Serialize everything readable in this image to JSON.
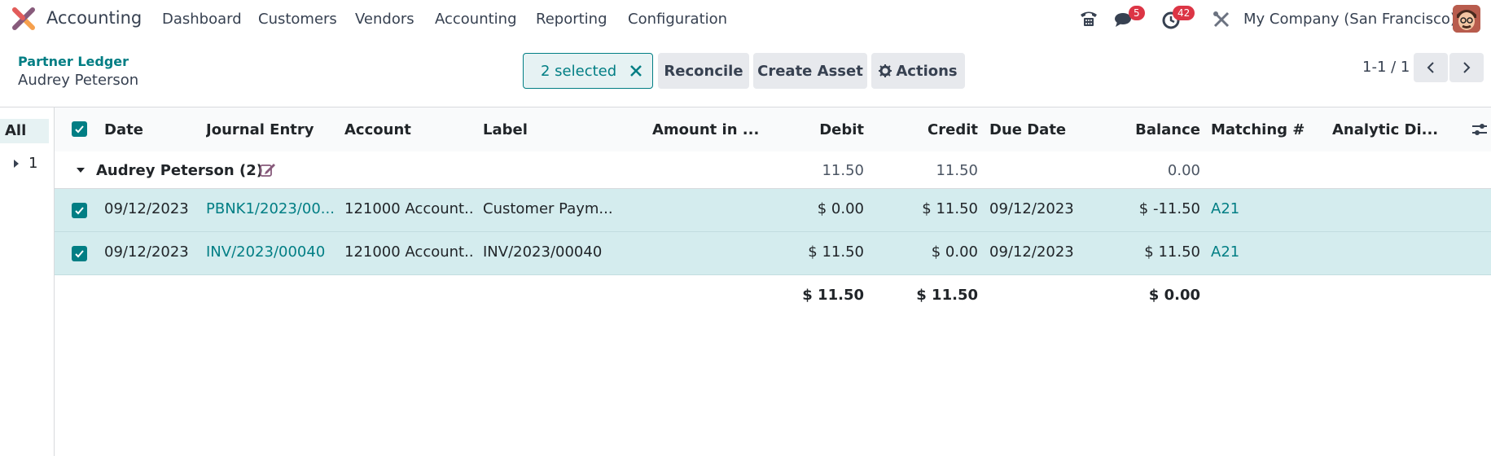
{
  "navbar": {
    "app_name": "Accounting",
    "menu": [
      "Dashboard",
      "Customers",
      "Vendors",
      "Accounting",
      "Reporting",
      "Configuration"
    ],
    "messages_count": "5",
    "activities_count": "42",
    "company": "My Company (San Francisco)"
  },
  "control": {
    "breadcrumb_parent": "Partner Ledger",
    "breadcrumb_current": "Audrey Peterson",
    "selected_label": "2 selected",
    "reconcile_label": "Reconcile",
    "create_asset_label": "Create Asset",
    "actions_label": "Actions",
    "pager": "1-1 / 1"
  },
  "side": {
    "all_label": "All",
    "item_label": "1"
  },
  "table": {
    "headers": {
      "date": "Date",
      "journal_entry": "Journal Entry",
      "account": "Account",
      "label": "Label",
      "amount_currency": "Amount in ...",
      "debit": "Debit",
      "credit": "Credit",
      "due_date": "Due Date",
      "balance": "Balance",
      "matching": "Matching #",
      "analytic": "Analytic Di..."
    },
    "group": {
      "name": "Audrey Peterson (2)",
      "debit": "11.50",
      "credit": "11.50",
      "balance": "0.00"
    },
    "rows": [
      {
        "date": "09/12/2023",
        "journal_entry": "PBNK1/2023/00...",
        "account": "121000 Account...",
        "label": "Customer Paym...",
        "debit": "$ 0.00",
        "credit": "$ 11.50",
        "due_date": "09/12/2023",
        "balance": "$ -11.50",
        "matching": "A21"
      },
      {
        "date": "09/12/2023",
        "journal_entry": "INV/2023/00040",
        "account": "121000 Account...",
        "label": "INV/2023/00040",
        "debit": "$ 11.50",
        "credit": "$ 0.00",
        "due_date": "09/12/2023",
        "balance": "$ 11.50",
        "matching": "A21"
      }
    ],
    "totals": {
      "debit": "$ 11.50",
      "credit": "$ 11.50",
      "balance": "$ 0.00"
    }
  },
  "colors": {
    "brand": "#017e84",
    "selected_row": "#d4ecee",
    "badge": "#dc3545"
  }
}
